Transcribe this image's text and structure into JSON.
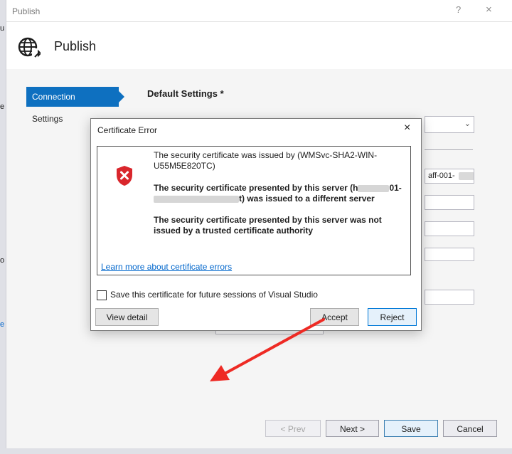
{
  "window": {
    "title": "Publish",
    "help_glyph": "?",
    "close_glyph": "×"
  },
  "header": {
    "heading": "Publish",
    "icon": "globe-publish-icon"
  },
  "nav": {
    "items": [
      {
        "label": "Connection",
        "selected": true
      },
      {
        "label": "Settings",
        "selected": false
      }
    ]
  },
  "section": {
    "title": "Default Settings *"
  },
  "form_fragments": {
    "site_name_suffix": "aff-001-"
  },
  "footer": {
    "prev": "< Prev",
    "next": "Next >",
    "save": "Save",
    "cancel": "Cancel"
  },
  "dialog": {
    "title": "Certificate Error",
    "close_glyph": "×",
    "icon": "shield-error-icon",
    "messages": {
      "issued_by": "The security certificate was issued by (WMSvc-SHA2-WIN-U55M5E820TC)",
      "different_server_a": "The security certificate presented by this server (h",
      "different_server_b": "01-",
      "different_server_c": "t) was issued to a different server",
      "not_trusted": "The security certificate presented by this server was not issued by a trusted certificate authority"
    },
    "link": "Learn more about certificate errors",
    "checkbox_label": "Save this certificate for future sessions of Visual Studio",
    "checkbox_checked": false,
    "buttons": {
      "view_detail": "View detail",
      "accept": "Accept",
      "reject": "Reject"
    }
  },
  "colors": {
    "accent": "#0e70c0",
    "error_red": "#d9262c",
    "annotation_arrow": "#ee2a24",
    "link": "#0066cc"
  },
  "annotation": {
    "type": "arrow",
    "icon": "red-annotation-arrow"
  }
}
